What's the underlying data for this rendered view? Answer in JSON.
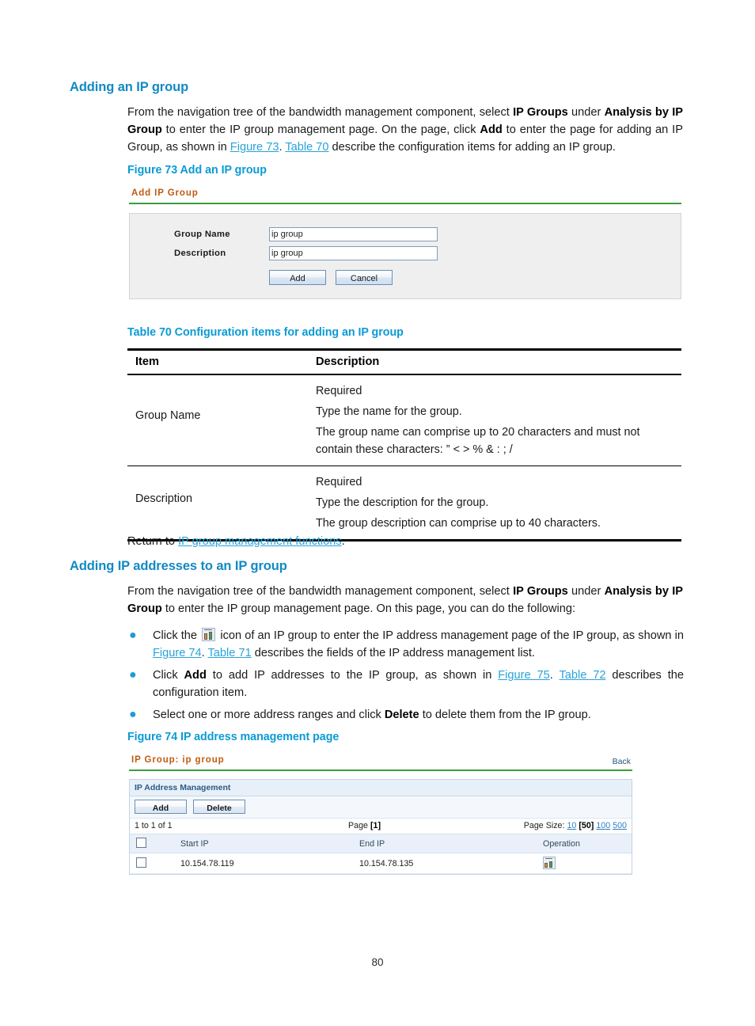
{
  "document": {
    "page_number": "80",
    "accent_heading_color": "#1289c4",
    "link_color": "#29a3d8"
  },
  "section_1": {
    "heading": "Adding an IP group",
    "paragraph": {
      "part1": "From the navigation tree of the bandwidth management component, select ",
      "bold1": "IP Groups",
      "part2": " under ",
      "bold2": "Analysis by IP Group",
      "part3": " to enter the IP group management page. On the page, click ",
      "bold3": "Add",
      "part4": " to enter the page for adding an IP Group, as shown in ",
      "xref1": "Figure 73",
      "part5": ". ",
      "xref2": "Table 70",
      "part6": " describe the configuration items for adding an IP group."
    }
  },
  "figure_73": {
    "caption": "Figure 73 Add an IP group",
    "app": {
      "title": "Add IP Group",
      "fields": [
        {
          "label": "Group Name",
          "value": "ip group"
        },
        {
          "label": "Description",
          "value": "ip group"
        }
      ],
      "buttons": [
        {
          "label": "Add"
        },
        {
          "label": "Cancel"
        }
      ]
    }
  },
  "table_70": {
    "caption": "Table 70 Configuration items for adding an IP group",
    "columns": [
      "Item",
      "Description"
    ],
    "rows": [
      {
        "item": "Group Name",
        "description_lines": [
          "Required",
          "Type the name for the group.",
          "The group name can comprise up to 20 characters and must not contain these characters: ” < > % & : ; /"
        ]
      },
      {
        "item": "Description",
        "description_lines": [
          "Required",
          "Type the description for the group.",
          "The group description can comprise up to 40 characters."
        ]
      }
    ]
  },
  "return_line": {
    "prefix": "Return to ",
    "link": "IP group management functions",
    "suffix": "."
  },
  "section_2": {
    "heading": "Adding IP addresses to an IP group",
    "paragraph": {
      "part1": "From the navigation tree of the bandwidth management component, select ",
      "bold1": "IP Groups",
      "part2": " under ",
      "bold2": "Analysis by IP Group",
      "part3": " to enter the IP group management page. On this page, you can do the following:"
    },
    "bullets": [
      {
        "icon": "ip-address-management-icon",
        "pre_icon": "Click the ",
        "part1": " icon of an IP group to enter the IP address management page of the IP group, as shown in ",
        "xref1": "Figure 74",
        "part2": ". ",
        "xref2": "Table 71",
        "part3": " describes the fields of the IP address management list."
      },
      {
        "part0": "Click ",
        "bold1": "Add",
        "part1": " to add IP addresses to the IP group, as shown in ",
        "xref1": "Figure 75",
        "part2": ". ",
        "xref2": "Table 72",
        "part3": " describes the configuration item."
      },
      {
        "part0": "Select one or more address ranges and click ",
        "bold1": "Delete",
        "part1": " to delete them from the IP group."
      }
    ]
  },
  "figure_74": {
    "caption": "Figure 74 IP address management page",
    "app": {
      "title": "IP Group: ip group",
      "back_link": "Back",
      "panel_heading": "IP Address Management",
      "buttons": [
        {
          "label": "Add"
        },
        {
          "label": "Delete"
        }
      ],
      "pager": {
        "range": "1 to 1 of 1",
        "page_label": "Page ",
        "page_current": "[1]",
        "page_size_label": "Page Size: ",
        "sizes": [
          "10",
          "[50]",
          "100",
          "500"
        ],
        "selected_size": "[50]"
      },
      "table": {
        "columns": [
          "",
          "Start IP",
          "End IP",
          "Operation"
        ],
        "rows": [
          {
            "selected": false,
            "start_ip": "10.154.78.119",
            "end_ip": "10.154.78.135",
            "operation_icon": "ip-address-management-icon"
          }
        ]
      }
    }
  }
}
